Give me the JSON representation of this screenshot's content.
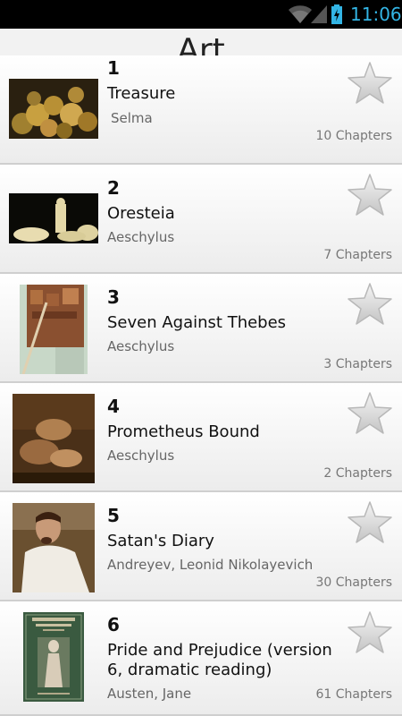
{
  "status_bar": {
    "time": "11:06",
    "icons": [
      "wifi-icon",
      "signal-icon",
      "battery-charging-icon"
    ]
  },
  "header": {
    "title": "Art"
  },
  "books": [
    {
      "number": "1",
      "title": "Treasure",
      "author": "Selma",
      "chapters": "10 Chapters"
    },
    {
      "number": "2",
      "title": "Oresteia",
      "author": "Aeschylus",
      "chapters": "7 Chapters"
    },
    {
      "number": "3",
      "title": "Seven Against Thebes",
      "author": "Aeschylus",
      "chapters": "3 Chapters"
    },
    {
      "number": "4",
      "title": "Prometheus Bound",
      "author": "Aeschylus",
      "chapters": "2 Chapters"
    },
    {
      "number": "5",
      "title": "Satan's Diary",
      "author": "Andreyev, Leonid Nikolayevich",
      "chapters": "30 Chapters"
    },
    {
      "number": "6",
      "title": "Pride and Prejudice (version 6, dramatic reading)",
      "author": "Austen, Jane",
      "chapters": "61 Chapters"
    }
  ],
  "colors": {
    "status_bar_bg": "#000000",
    "status_accent": "#33b5e5",
    "row_bg": "#f5f5f5",
    "divider": "#cfcfcf",
    "star": "#d4d4d4"
  }
}
